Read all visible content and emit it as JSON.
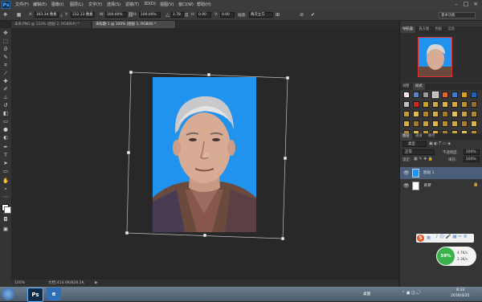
{
  "app": {
    "logo": "Ps",
    "menu": [
      "文件(F)",
      "编辑(E)",
      "图像(I)",
      "图层(L)",
      "文字(Y)",
      "选择(S)",
      "滤镜(T)",
      "3D(D)",
      "视图(V)",
      "窗口(W)",
      "帮助(H)"
    ]
  },
  "options": {
    "x_label": "X:",
    "x_value": "163.34 像素",
    "y_label": "Y:",
    "y_value": "232.13 像素",
    "w_label": "W:",
    "w_value": "100.00%",
    "h_label": "H:",
    "h_value": "100.00%",
    "angle_value": "1.78",
    "hskew_label": "H:",
    "hskew_value": "0.00",
    "vskew_label": "V:",
    "vskew_value": "0.00",
    "interp_label": "插值:",
    "interp_value": "两次立方",
    "workspace": "基本功能"
  },
  "tabs": [
    {
      "label": "未命.PNG @ 133% (图层 2, RGB/8#) *"
    },
    {
      "label": "未标题-1 @ 100% (图层 1, RGB/8) *"
    }
  ],
  "status": {
    "zoom": "100%",
    "doc": "文档:414.6K/828.2K"
  },
  "right_panel": {
    "nav_tabs": [
      "导航器",
      "直方图",
      "色板",
      "信息"
    ],
    "style_tabs": [
      "调整",
      "样式"
    ],
    "layers_tabs": [
      "图层",
      "通道",
      "路径"
    ],
    "kind": "类型",
    "blend_mode": "正常",
    "opacity_label": "不透明度:",
    "opacity": "100%",
    "lock_label": "锁定:",
    "fill_label": "填充:",
    "fill": "100%",
    "layers": [
      {
        "name": "图层 1"
      },
      {
        "name": "背景"
      }
    ]
  },
  "ime": {
    "logo": "S",
    "label": "英"
  },
  "speed": {
    "percent": "59%",
    "up": "4.7K/s",
    "down": "2.3K/s"
  },
  "taskbar": {
    "time": "8:33",
    "date": "2016/4/25",
    "desktop": "桌面"
  },
  "colors": {
    "canvas_bg": "#282828",
    "photo_bg": "#1f93ee",
    "panel": "#353535",
    "accent_green": "#3bb34a",
    "layer_selected": "#4a5e7a"
  }
}
